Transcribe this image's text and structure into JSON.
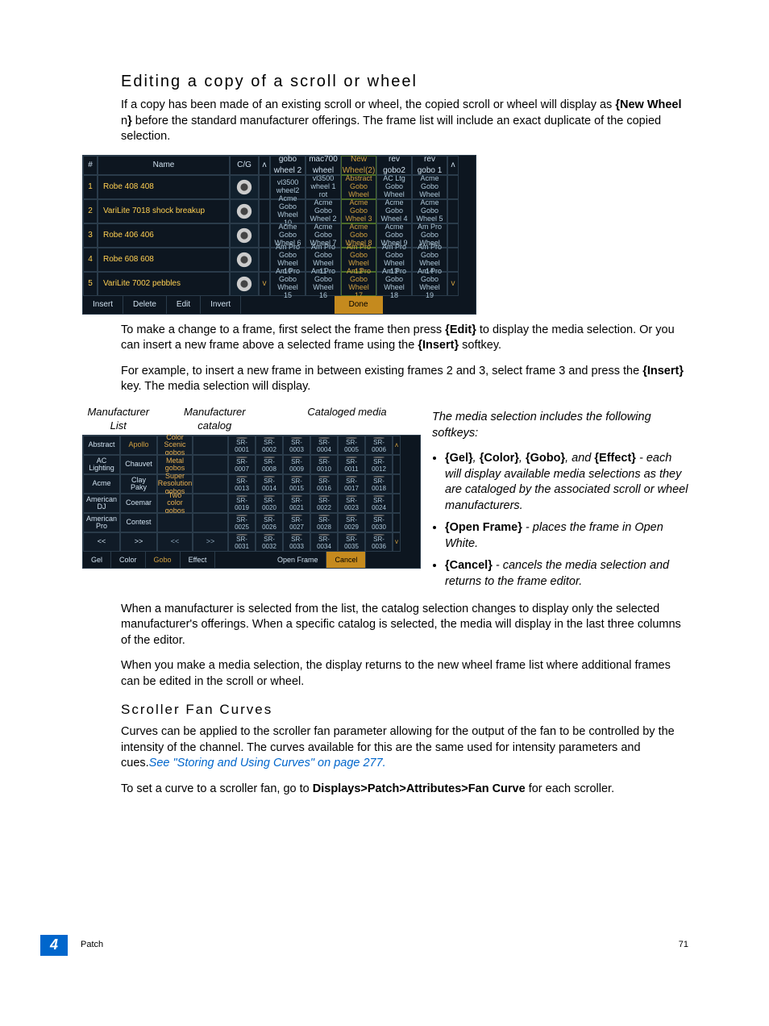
{
  "heading1": "Editing a copy of a scroll or wheel",
  "para1_a": "If a copy has been made of an existing scroll or wheel, the copied scroll or wheel will display as ",
  "para1_b": "{New Wheel ",
  "para1_c": "n",
  "para1_d": "}",
  "para1_e": " before the standard manufacturer offerings. The frame list will include an exact duplicate of the copied selection.",
  "wheel_editor": {
    "headers": [
      "#",
      "Name",
      "C/G",
      "",
      "gobo wheel 2",
      "mac700 wheel",
      "New Wheel(2)",
      "rev gobo2",
      "rev gobo 1",
      ""
    ],
    "rows": [
      {
        "n": "1",
        "name": "Robe 408 408",
        "cells": [
          "vl3500 wheel2",
          "vl3500 wheel 1 rot",
          "Abstract Gobo Wheel",
          "AC Ltg Gobo Wheel",
          "Acme Gobo Wheel"
        ]
      },
      {
        "n": "2",
        "name": "VariLite 7018 shock breakup",
        "cells": [
          "Acme Gobo Wheel 10",
          "Acme Gobo Wheel 2",
          "Acme Gobo Wheel 3",
          "Acme Gobo Wheel 4",
          "Acme Gobo Wheel 5"
        ]
      },
      {
        "n": "3",
        "name": "Robe 406 406",
        "cells": [
          "Acme Gobo Wheel 6",
          "Acme Gobo Wheel 7",
          "Acme Gobo Wheel 8",
          "Acme Gobo Wheel 9",
          "Am Pro Gobo Wheel"
        ]
      },
      {
        "n": "4",
        "name": "Robe 608 608",
        "cells": [
          "Am Pro Gobo Wheel 10",
          "Am Pro Gobo Wheel 11",
          "Am Pro Gobo Wheel 12",
          "Am Pro Gobo Wheel 13",
          "Am Pro Gobo Wheel 14"
        ]
      },
      {
        "n": "5",
        "name": "VariLite 7002 pebbles",
        "cells": [
          "Am Pro Gobo Wheel 15",
          "Am Pro Gobo Wheel 16",
          "Am Pro Gobo Wheel 17",
          "Am Pro Gobo Wheel 18",
          "Am Pro Gobo Wheel 19"
        ]
      }
    ],
    "scroll_up": "ʌ",
    "scroll_dn": "v",
    "footer": {
      "insert": "Insert",
      "delete": "Delete",
      "edit": "Edit",
      "invert": "Invert",
      "done": "Done"
    },
    "new_col_index": 2
  },
  "para2_a": "To make a change to a frame, first select the frame then press ",
  "para2_b": "{Edit}",
  "para2_c": " to display the media selection. Or you can insert a new frame above a selected frame using the ",
  "para2_d": "{Insert}",
  "para2_e": " softkey.",
  "para3_a": "For example, to insert a new frame in between existing frames 2 and 3, select frame 3 and press the ",
  "para3_b": "{Insert}",
  "para3_c": " key. The media selection will display.",
  "callout_mfr_list": "Manufacturer List",
  "callout_mfr_cat": "Manufacturer catalog",
  "callout_media": "Cataloged media",
  "media_editor": {
    "mfr_col1": [
      "Abstract",
      "AC Lighting",
      "Acme",
      "American DJ",
      "American Pro",
      "<<"
    ],
    "mfr_col2": [
      "Apollo",
      "Chauvet",
      "Clay Paky",
      "Coemar",
      "Contest",
      ">>"
    ],
    "cat_col1": [
      "Color Scenic gobos",
      "Metal gobos",
      "Super Resolution gobos",
      "Two color gobos",
      "",
      "<<"
    ],
    "cat_col2": [
      "",
      "",
      "",
      "",
      "",
      ">>"
    ],
    "media_rows": [
      [
        "SR-0001",
        "SR-0002",
        "SR-0003",
        "SR-0004",
        "SR-0005",
        "SR-0006"
      ],
      [
        "SR-0007",
        "SR-0008",
        "SR-0009",
        "SR-0010",
        "SR-0011",
        "SR-0012"
      ],
      [
        "SR-0013",
        "SR-0014",
        "SR-0015",
        "SR-0016",
        "SR-0017",
        "SR-0018"
      ],
      [
        "SR-0019",
        "SR-0020",
        "SR-0021",
        "SR-0022",
        "SR-0023",
        "SR-0024"
      ],
      [
        "SR-0025",
        "SR-0026",
        "SR-0027",
        "SR-0028",
        "SR-0029",
        "SR-0030"
      ],
      [
        "SR-0031",
        "SR-0032",
        "SR-0033",
        "SR-0034",
        "SR-0035",
        "SR-0036"
      ]
    ],
    "scroll_up": "ʌ",
    "scroll_dn": "v",
    "footer": {
      "gel": "Gel",
      "color": "Color",
      "gobo": "Gobo",
      "effect": "Effect",
      "open": "Open Frame",
      "cancel": "Cancel"
    }
  },
  "softkeys_intro": "The media selection includes the following softkeys:",
  "bullet1_a": "{Gel}",
  "bullet1_b": ", ",
  "bullet1_c": "{Color}",
  "bullet1_d": ", ",
  "bullet1_e": "{Gobo}",
  "bullet1_f": ", and ",
  "bullet1_g": "{Effect}",
  "bullet1_rest": " - each will display available media selections as they are cataloged by the associated scroll or wheel manufacturers.",
  "bullet2_a": "{Open Frame}",
  "bullet2_rest": " - places the frame in Open White.",
  "bullet3_a": "{Cancel}",
  "bullet3_rest": " - cancels the media selection and returns to the frame editor.",
  "para4": "When a manufacturer is selected from the list, the catalog selection changes to display only the selected manufacturer's offerings. When a specific catalog is selected, the media will display in the last three columns of the editor.",
  "para5": "When you make a media selection, the display returns to the new wheel frame list where additional frames can be edited in the scroll or wheel.",
  "heading2": "Scroller Fan Curves",
  "para6_a": "Curves can be applied to the scroller fan parameter allowing for the output of the fan to be controlled by the intensity of the channel. The curves available for this are the same used for intensity parameters and cues.",
  "para6_link": "See \"Storing and Using Curves\" on page 277.",
  "para7_a": "To set a curve to a scroller fan, go to ",
  "para7_b": "Displays>Patch>Attributes>Fan Curve",
  "para7_c": " for each scroller.",
  "footer": {
    "chapter": "4",
    "label": "Patch",
    "page": "71"
  }
}
